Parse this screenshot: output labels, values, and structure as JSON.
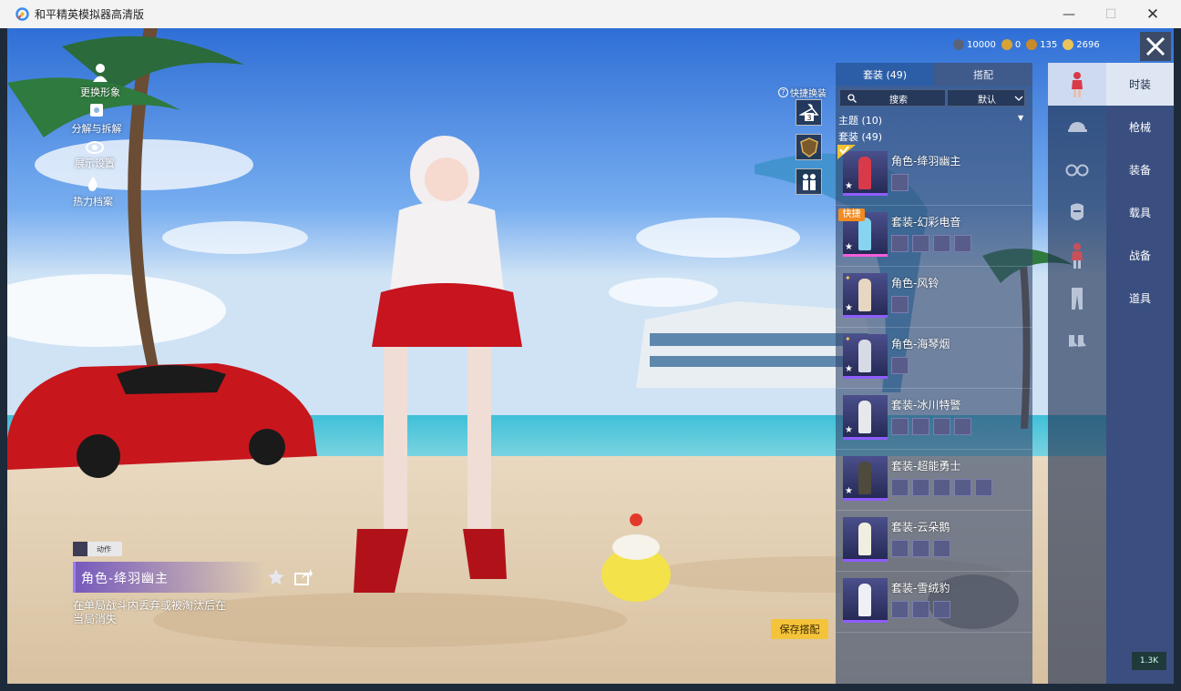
{
  "window": {
    "title": "和平精英模拟器高清版",
    "controls": {
      "minimize": "—",
      "maximize": "☐",
      "close": "✕"
    }
  },
  "left_menu": {
    "items": [
      {
        "label": "更换形象",
        "icon": "person-icon"
      },
      {
        "label": "分解与拆解",
        "icon": "puzzle-icon"
      },
      {
        "label": "展示设置",
        "icon": "eye-icon"
      },
      {
        "label": "热力档案",
        "icon": "flame-icon"
      }
    ]
  },
  "character_info": {
    "badge": "动作",
    "name": "角色-绛羽幽主",
    "description": "在单局战斗内丢弃或被淘汰后在当局消失"
  },
  "save_button": "保存搭配",
  "currencies": [
    {
      "value": "10000",
      "color": "#5a6378"
    },
    {
      "value": "0",
      "color": "#d7a332"
    },
    {
      "value": "135",
      "color": "#c98a2a"
    },
    {
      "value": "2696",
      "color": "#e8c45a"
    }
  ],
  "quick_change": {
    "label": "快捷换装",
    "help_glyph": "?",
    "slot_number": "3"
  },
  "panel": {
    "tabs": [
      {
        "label": "套装 (49)"
      },
      {
        "label": "搭配"
      }
    ],
    "search_placeholder": "搜索",
    "sort_label": "默认",
    "theme_row": "主题 (10)",
    "section_row": "套装 (49)",
    "quick_tag": "快捷",
    "items": [
      {
        "name": "角色-绛羽幽主",
        "subs": 1,
        "color": "#d83a4a",
        "equipped": true
      },
      {
        "name": "套装-幻彩电音",
        "subs": 4,
        "color": "#86d4ef",
        "quick": true
      },
      {
        "name": "角色-风铃",
        "subs": 1,
        "color": "#e7d7c2"
      },
      {
        "name": "角色-海琴烟",
        "subs": 1,
        "color": "#d7dbe6"
      },
      {
        "name": "套装-冰川特警",
        "subs": 4,
        "color": "#e8e8ec"
      },
      {
        "name": "套装-超能勇士",
        "subs": 5,
        "color": "#4e4a3c"
      },
      {
        "name": "套装-云朵鹅",
        "subs": 3,
        "color": "#f0eee0"
      },
      {
        "name": "套装-雪绒豹",
        "subs": 3,
        "color": "#eef0f6"
      }
    ]
  },
  "categories": [
    {
      "label": "时装",
      "icon": "character-icon"
    },
    {
      "label": "枪械",
      "icon": "cap-icon"
    },
    {
      "label": "装备",
      "icon": "goggles-icon"
    },
    {
      "label": "载具",
      "icon": "mask-icon"
    },
    {
      "label": "战备",
      "icon": "outfit-icon"
    },
    {
      "label": "道具",
      "icon": "pants-icon"
    },
    {
      "label": "",
      "icon": "shoes-icon"
    }
  ],
  "corner_badge": "1.3K"
}
